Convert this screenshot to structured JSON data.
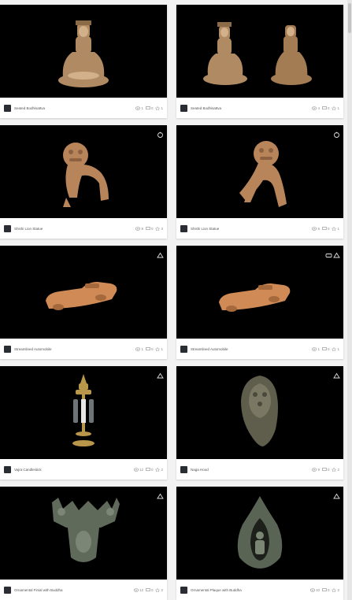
{
  "models": [
    {
      "title": "Seated Bodhisattva",
      "views": "1",
      "comments": "0",
      "likes": "1",
      "subject": "bodhisattva-single-statue"
    },
    {
      "title": "Seated Bodhisattva",
      "views": "4",
      "comments": "0",
      "likes": "1",
      "subject": "bodhisattva-pair-statues"
    },
    {
      "title": "Shishi Lion Statue",
      "views": "8",
      "comments": "0",
      "likes": "3",
      "subject": "shishi-lion-statue"
    },
    {
      "title": "Shishi Lion Statue",
      "views": "5",
      "comments": "0",
      "likes": "1",
      "subject": "shishi-lion-statue"
    },
    {
      "title": "Streamlined Automobile",
      "views": "1",
      "comments": "0",
      "likes": "1",
      "subject": "wooden-car-model"
    },
    {
      "title": "Streamlined Automobile",
      "views": "1",
      "comments": "0",
      "likes": "1",
      "subject": "wooden-car-model"
    },
    {
      "title": "Vajra Candlestick",
      "views": "12",
      "comments": "0",
      "likes": "2",
      "subject": "vajra-candlestick"
    },
    {
      "title": "Naga Hood",
      "views": "9",
      "comments": "0",
      "likes": "2",
      "subject": "naga-hood-relief"
    },
    {
      "title": "Ornamental Finial with Buddha",
      "views": "12",
      "comments": "0",
      "likes": "2",
      "subject": "bronze-finial"
    },
    {
      "title": "Ornamental Plaque with Buddha",
      "views": "10",
      "comments": "0",
      "likes": "2",
      "subject": "bronze-arch-plaque"
    }
  ],
  "colors": {
    "thumb_bg": "#000000",
    "card_bg": "#ffffff",
    "page_bg": "#f2f2f2",
    "text": "#555555"
  }
}
